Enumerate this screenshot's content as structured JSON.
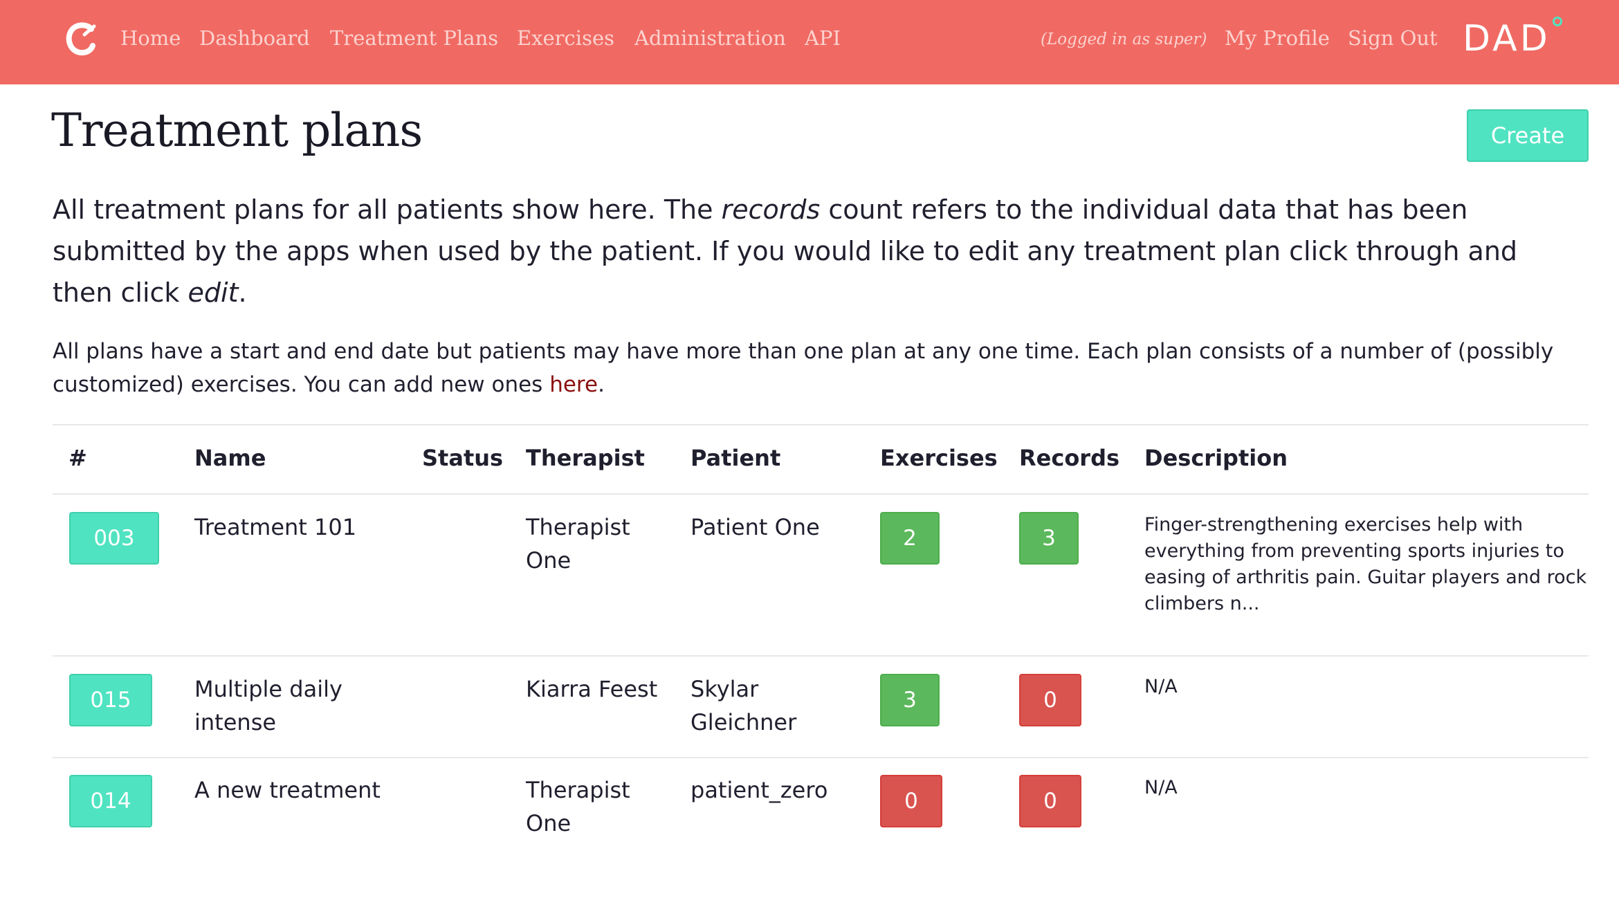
{
  "navbar": {
    "links": [
      "Home",
      "Dashboard",
      "Treatment Plans",
      "Exercises",
      "Administration",
      "API"
    ],
    "logged_in": "(Logged in as super)",
    "profile": "My Profile",
    "sign_out": "Sign Out",
    "brand": "DAD",
    "logo_icon": "c-logo-icon",
    "color": "#f06a63"
  },
  "page": {
    "title": "Treatment plans",
    "create_label": "Create",
    "lead_part1": "All treatment plans for all patients show here. The ",
    "lead_em1": "records",
    "lead_part2": " count refers to the individual data that has been submitted by the apps when used by the patient. If you would like to edit any treatment plan click through and then click ",
    "lead_em2": "edit",
    "lead_part3": ".",
    "info_text": "All plans have a start and end date but patients may have more than one plan at any one time. Each plan consists of a number of (possibly customized) exercises. You can add new ones ",
    "info_link": "here",
    "info_end": "."
  },
  "table": {
    "headers": [
      "#",
      "Name",
      "Status",
      "Therapist",
      "Patient",
      "Exercises",
      "Records",
      "Description"
    ],
    "rows": [
      {
        "id": "003",
        "name": "Treatment 101",
        "status": "",
        "therapist": "Therapist One",
        "patient": "Patient One",
        "exercises": "2",
        "records": "3",
        "description": "Finger-strengthening exercises help with everything from preventing sports injuries to easing of arthritis pain. Guitar players and rock climbers n..."
      },
      {
        "id": "015",
        "name": "Multiple daily intense",
        "status": "",
        "therapist": "Kiarra Feest",
        "patient": "Skylar Gleichner",
        "exercises": "3",
        "records": "0",
        "description": "N/A"
      },
      {
        "id": "014",
        "name": "A new treatment",
        "status": "",
        "therapist": "Therapist One",
        "patient": "patient_zero",
        "exercises": "0",
        "records": "0",
        "description": "N/A"
      }
    ]
  },
  "colors": {
    "accent": "#4fe3c1",
    "success": "#5cb85c",
    "danger": "#d9534f",
    "link": "#8b0f0f"
  }
}
